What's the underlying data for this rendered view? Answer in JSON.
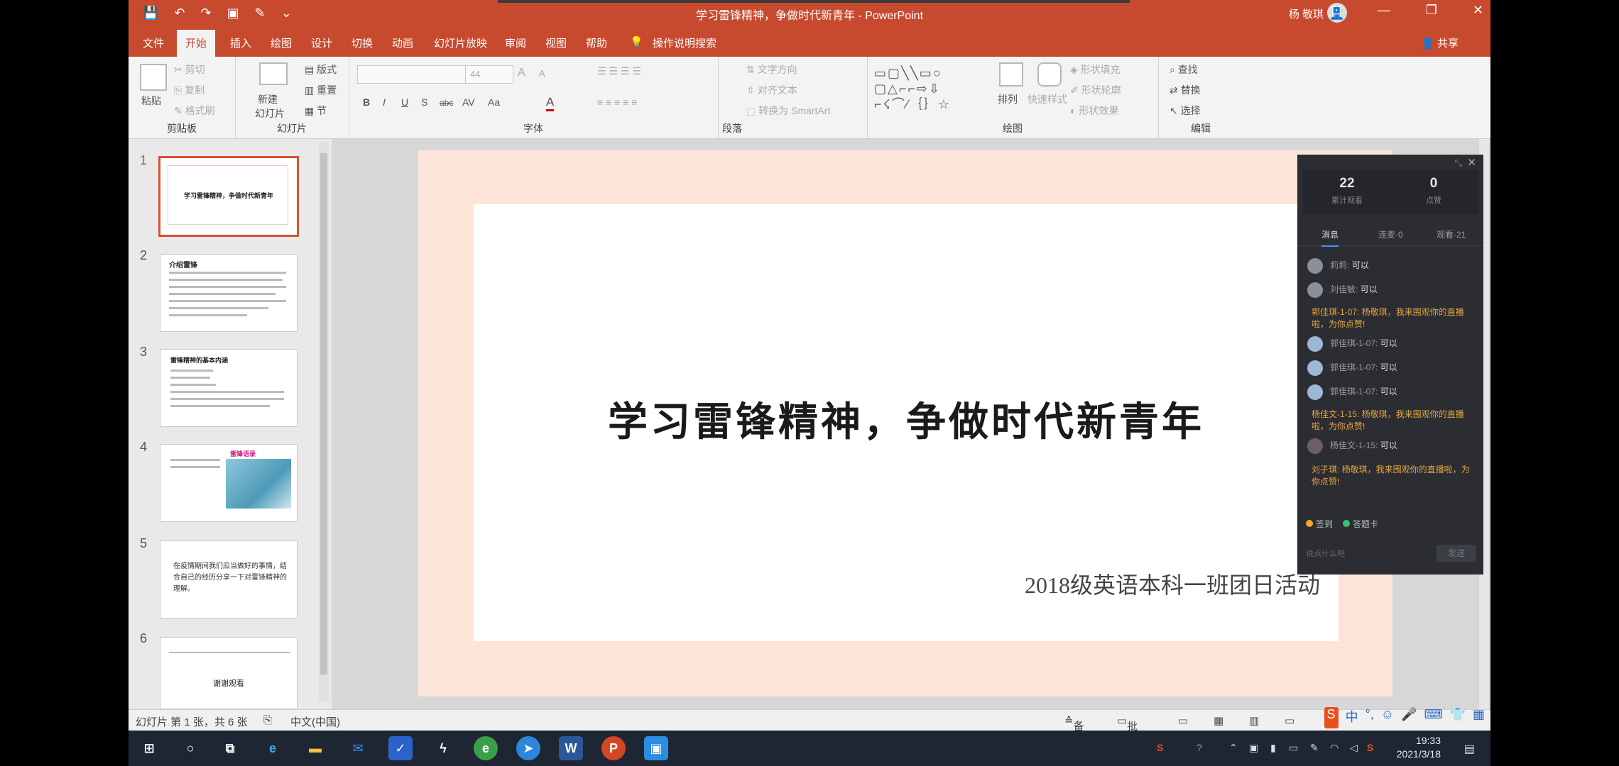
{
  "window": {
    "title": "学习雷锋精神，争做时代新青年 - PowerPoint",
    "user": "杨 敬琪",
    "qat": [
      "💾",
      "↶",
      "↷",
      "▣",
      "✎",
      "⌄"
    ],
    "controls": [
      "⊡",
      "—",
      "❐",
      "✕"
    ]
  },
  "tabs": [
    "文件",
    "开始",
    "插入",
    "绘图",
    "设计",
    "切换",
    "动画",
    "幻灯片放映",
    "审阅",
    "视图",
    "帮助",
    "操作说明搜索"
  ],
  "share": "共享",
  "ribbon": {
    "clipboard": {
      "paste": "粘贴",
      "cut": "剪切",
      "copy": "复制",
      "format_painter": "格式刷",
      "label": "剪贴板"
    },
    "slides": {
      "new_slide": "新建",
      "new_slide2": "幻灯片",
      "layout": "版式",
      "reset": "重置",
      "section": "节",
      "label": "幻灯片"
    },
    "font": {
      "size": "44",
      "bold": "B",
      "italic": "I",
      "underline": "U",
      "strike": "S",
      "abc": "abc",
      "spacing": "AV",
      "case": "Aa",
      "color": "A",
      "grow": "A",
      "shrink": "A",
      "label": "字体"
    },
    "paragraph": {
      "direction": "文字方向",
      "align": "对齐文本",
      "smartart": "转换为 SmartArt",
      "label": "段落"
    },
    "drawing": {
      "shapes": "▭▢╲╲▭○\n▢△⌐⌐⇨⇩\n⌐☇⌒∕｛｝☆",
      "arrange": "排列",
      "quick_styles": "快速样式",
      "fill": "形状填充",
      "outline": "形状轮廓",
      "effect": "形状效果",
      "label": "绘图"
    },
    "editing": {
      "find": "查找",
      "replace": "替换",
      "select": "选择",
      "label": "编辑"
    }
  },
  "thumbnails": [
    {
      "num": "1",
      "title": "学习雷锋精神，争做时代新青年"
    },
    {
      "num": "2",
      "title": "介绍雷锋"
    },
    {
      "num": "3",
      "title": "雷锋精神的基本内涵"
    },
    {
      "num": "4",
      "title": "雷锋语录"
    },
    {
      "num": "5",
      "title": "在疫情期间我们应当做好的事情，结合自己的经历分享一下对雷锋精神的理解。"
    },
    {
      "num": "6",
      "title": "谢谢观看"
    }
  ],
  "slide": {
    "title": "学习雷锋精神，争做时代新青年",
    "subtitle": "2018级英语本科一班团日活动"
  },
  "live": {
    "viewers": "22",
    "viewers_label": "累计观看",
    "likes": "0",
    "likes_label": "点赞",
    "tabs": [
      "消息",
      "连麦·0",
      "观看·21"
    ],
    "messages": [
      {
        "type": "user",
        "name": "莉莉:",
        "text": "可以"
      },
      {
        "type": "user",
        "name": "刘佳敏:",
        "text": "可以"
      },
      {
        "type": "sys",
        "text": "郭佳琪-1-07: 杨敬琪，我来围观你的直播啦，为你点赞!"
      },
      {
        "type": "user",
        "name": "郭佳琪-1-07:",
        "text": "可以"
      },
      {
        "type": "user",
        "name": "郭佳琪-1-07:",
        "text": "可以"
      },
      {
        "type": "user",
        "name": "郭佳琪-1-07:",
        "text": "可以"
      },
      {
        "type": "sys",
        "text": "杨佳文-1-15: 杨敬琪，我来围观你的直播啦，为你点赞!"
      },
      {
        "type": "user",
        "name": "杨佳文-1-15:",
        "text": "可以"
      },
      {
        "type": "sys",
        "text": "刘子琪: 杨敬琪，我来围观你的直播啦，为你点赞!"
      }
    ],
    "badge1": "签到",
    "badge2": "答题卡",
    "input_placeholder": "说点什么吧",
    "send": "发送"
  },
  "statusbar": {
    "slide_info": "幻灯片 第 1 张，共 6 张",
    "lang": "中文(中国)",
    "notes": "备注",
    "comments": "批注"
  },
  "ime": [
    "S",
    "中",
    "°,",
    "☺",
    "🎤",
    "⌨",
    "👕",
    "▦"
  ],
  "taskbar": {
    "time": "19:33",
    "date": "2021/3/18"
  },
  "colors": {
    "accent": "#c84a2e",
    "slide_bg": "#fde4d8",
    "live_bg": "#2b2d33"
  }
}
